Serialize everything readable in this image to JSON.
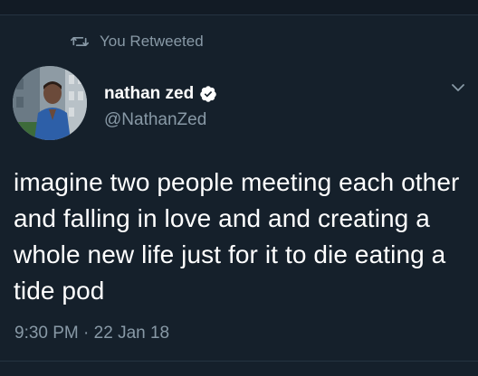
{
  "retweet": {
    "label": "You Retweeted",
    "icon": "retweet-icon"
  },
  "author": {
    "display_name": "nathan zed",
    "handle": "@NathanZed",
    "verified": true,
    "verified_icon": "verified-badge-icon",
    "avatar": "avatar"
  },
  "tweet": {
    "text": "imagine two people meeting each other and falling in love and and creating a whole new life just for it to die eating a tide pod",
    "time": "9:30 PM",
    "separator": "·",
    "date": "22 Jan 18"
  },
  "menu": {
    "icon": "chevron-down-icon"
  },
  "colors": {
    "background": "#15202b",
    "text": "#ffffff",
    "muted": "#8899a6",
    "divider": "#253341"
  }
}
